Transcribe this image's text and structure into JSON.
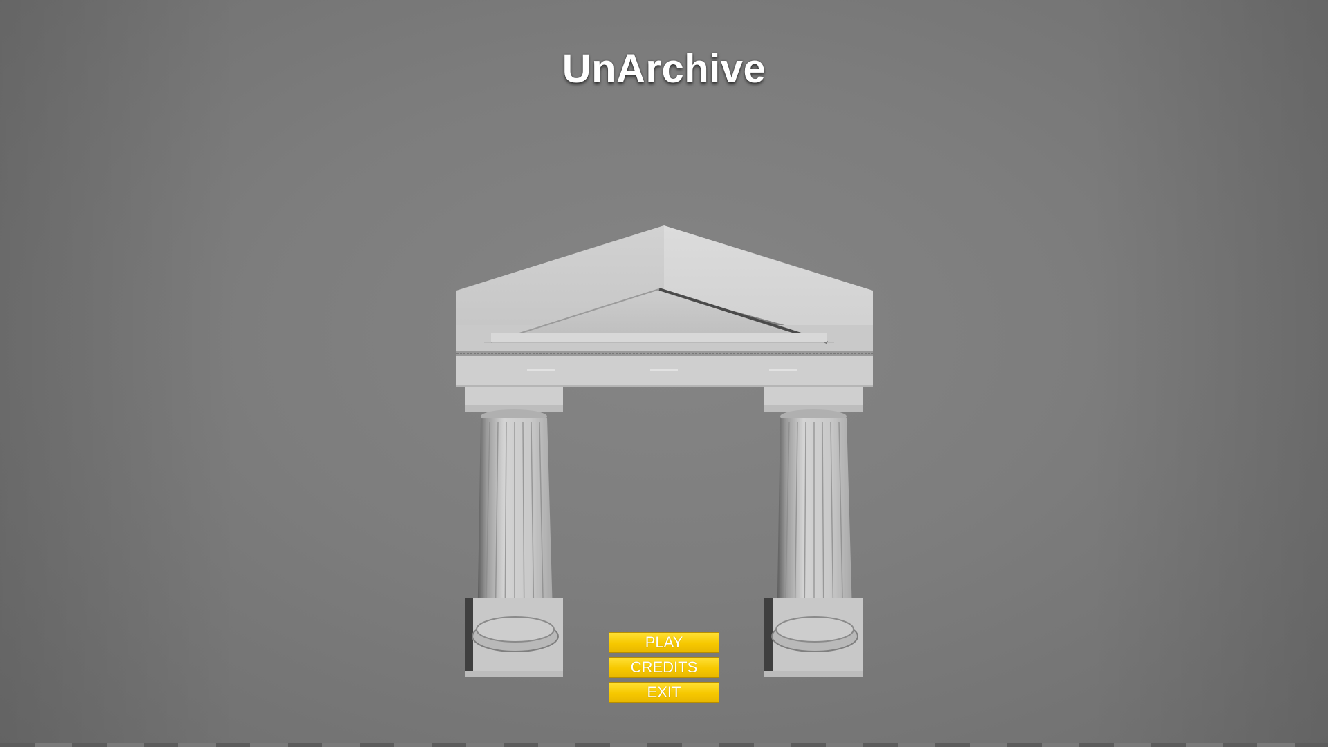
{
  "title": "UnArchive",
  "menu": {
    "play_label": "PLAY",
    "credits_label": "CREDITS",
    "exit_label": "EXIT"
  },
  "colors": {
    "button_fill": "#f6c800",
    "button_text": "#ffffff",
    "background": "#7d7d7d",
    "temple_stone": "#d6d6d6"
  },
  "scene": {
    "object": "temple-gate-with-two-fluted-columns"
  }
}
